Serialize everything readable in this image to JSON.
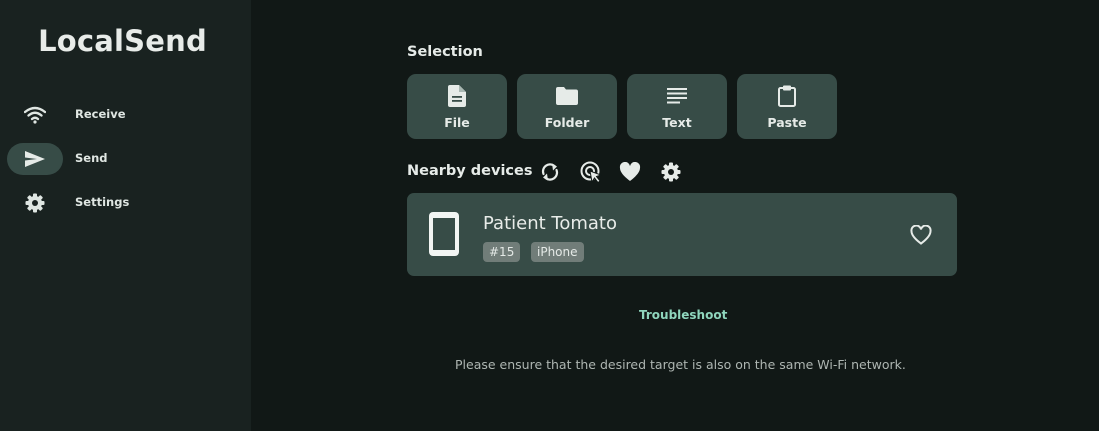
{
  "app": {
    "title": "LocalSend"
  },
  "sidebar": {
    "items": [
      {
        "label": "Receive",
        "icon": "wifi-icon",
        "active": false
      },
      {
        "label": "Send",
        "icon": "send-icon",
        "active": true
      },
      {
        "label": "Settings",
        "icon": "gear-icon",
        "active": false
      }
    ]
  },
  "selection": {
    "title": "Selection",
    "buttons": [
      {
        "label": "File",
        "icon": "file-icon"
      },
      {
        "label": "Folder",
        "icon": "folder-icon"
      },
      {
        "label": "Text",
        "icon": "text-icon"
      },
      {
        "label": "Paste",
        "icon": "clipboard-icon"
      }
    ]
  },
  "nearby": {
    "title": "Nearby devices",
    "tools": [
      "refresh-icon",
      "scan-icon",
      "favorites-icon",
      "settings-icon"
    ],
    "devices": [
      {
        "name": "Patient Tomato",
        "badges": [
          "#15",
          "iPhone"
        ],
        "icon": "phone-icon",
        "favorite": false
      }
    ]
  },
  "troubleshoot": {
    "label": "Troubleshoot"
  },
  "hint": {
    "text": "Please ensure that the desired target is also on the same Wi-Fi network."
  },
  "colors": {
    "background": "#111816",
    "sidebar": "#192220",
    "surface": "#374c47",
    "accent": "#8fd6bd",
    "badge": "#717d79"
  }
}
